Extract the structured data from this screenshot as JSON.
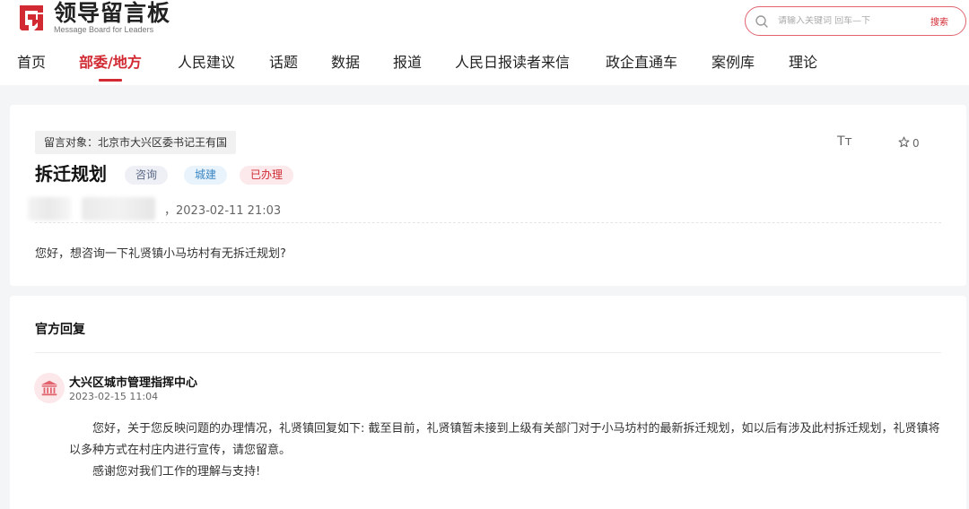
{
  "header": {
    "logo_cn": "领导留言板",
    "logo_en": "Message Board for Leaders",
    "brand_color": "#d12a33",
    "search_placeholder": "请输入关键词 回车—下",
    "search_button": "搜索"
  },
  "nav": {
    "items": [
      {
        "label": "首页"
      },
      {
        "label": "部委/地方"
      },
      {
        "label": "人民建议"
      },
      {
        "label": "话题"
      },
      {
        "label": "数据"
      },
      {
        "label": "报道"
      },
      {
        "label": "人民日报读者来信"
      },
      {
        "label": "政企直通车"
      },
      {
        "label": "案例库"
      },
      {
        "label": "理论"
      }
    ],
    "active_index": 1
  },
  "message": {
    "target": "留言对象：北京市大兴区委书记王有国",
    "title": "拆迁规划",
    "tags": [
      "咨询",
      "城建",
      "已办理"
    ],
    "font_size_icon": "Tт",
    "favorite_count": "0",
    "time": "，2023-02-11 21:03",
    "content": "您好，想咨询一下礼贤镇小马坊村有无拆迁规划?"
  },
  "reply": {
    "header": "官方回复",
    "org_name": "大兴区城市管理指挥中心",
    "org_time": "2023-02-15 11:04",
    "paragraph1": "您好，关于您反映问题的办理情况，礼贤镇回复如下: 截至目前，礼贤镇暂未接到上级有关部门对于小马坊村的最新拆迁规划，如以后有涉及此村拆迁规划，礼贤镇将以多种方式在村庄内进行宣传，请您留意。",
    "paragraph2": "感谢您对我们工作的理解与支持!"
  }
}
